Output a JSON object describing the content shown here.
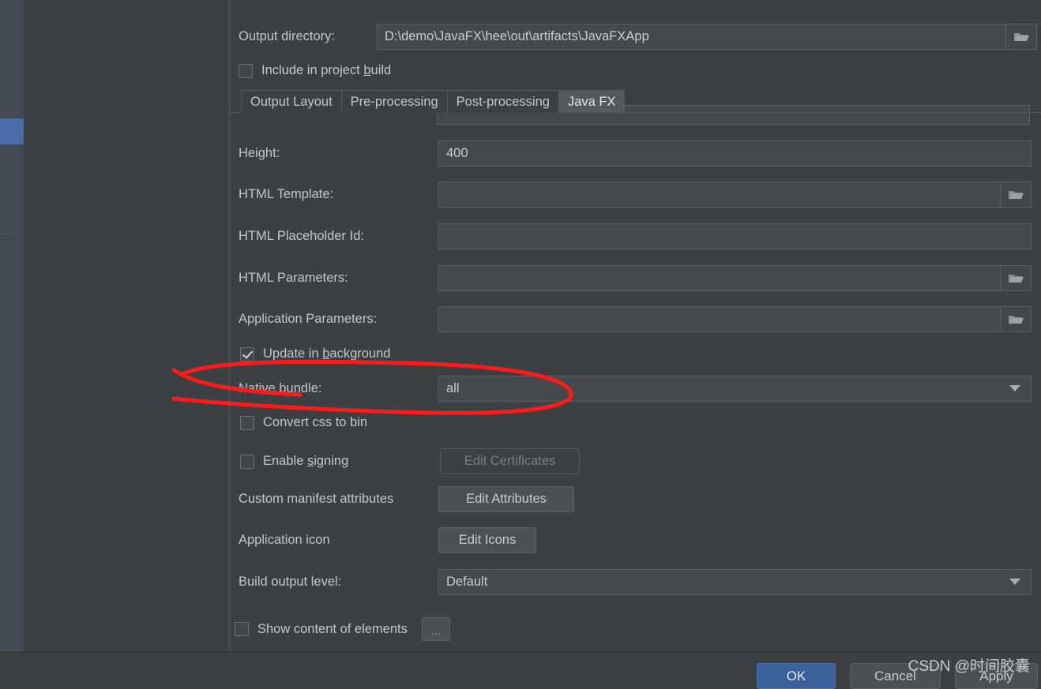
{
  "window": {
    "background_color": "#3c4043",
    "accent_color": "#4a6da7"
  },
  "output_directory": {
    "label": "Output directory:",
    "value": "D:\\demo\\JavaFX\\hee\\out\\artifacts\\JavaFXApp",
    "browse_icon": "folder-icon"
  },
  "include_in_build": {
    "label_pre": "Include in project ",
    "label_accel": "b",
    "label_post": "uild",
    "checked": false
  },
  "tabs": [
    {
      "label": "Output Layout",
      "active": false
    },
    {
      "label": "Pre-processing",
      "active": false
    },
    {
      "label": "Post-processing",
      "active": false
    },
    {
      "label": "Java FX",
      "active": true
    }
  ],
  "fields": {
    "height": {
      "label": "Height:",
      "value": "400"
    },
    "html_template": {
      "label": "HTML Template:",
      "value": "",
      "browse_icon": "folder-icon"
    },
    "html_placeholder_id": {
      "label": "HTML Placeholder Id:",
      "value": ""
    },
    "html_parameters": {
      "label": "HTML Parameters:",
      "value": "",
      "browse_icon": "folder-icon"
    },
    "application_parameters": {
      "label": "Application Parameters:",
      "value": "",
      "browse_icon": "folder-icon"
    }
  },
  "update_in_background": {
    "label_pre": "Update in ",
    "label_accel": "b",
    "label_post": "ackground",
    "checked": true
  },
  "native_bundle": {
    "label": "Native bundle:",
    "value": "all",
    "arrow_icon": "chevron-down-icon",
    "annotated": true
  },
  "convert_css_to_bin": {
    "label": "Convert css to bin",
    "checked": false
  },
  "enable_signing": {
    "label_pre": "Enable ",
    "label_accel": "s",
    "label_post": "igning",
    "checked": false,
    "button_label": "Edit Certificates",
    "button_enabled": false
  },
  "custom_manifest_attributes": {
    "label": "Custom manifest attributes",
    "button_label": "Edit  Attributes"
  },
  "application_icon": {
    "label": "Application icon",
    "button_label": "Edit Icons"
  },
  "build_output_level": {
    "label": "Build output level:",
    "value": "Default",
    "arrow_icon": "chevron-down-icon"
  },
  "show_content_of_elements": {
    "label": "Show content of elements",
    "checked": false,
    "button_label": "..."
  },
  "dialog_buttons": {
    "ok": "OK",
    "cancel": "Cancel",
    "apply": "Apply"
  },
  "annotation": {
    "color": "#fb1b1b",
    "shape": "hand-drawn-ellipse",
    "target": "Native bundle row"
  },
  "watermark": {
    "text": "CSDN @时间胶囊"
  }
}
